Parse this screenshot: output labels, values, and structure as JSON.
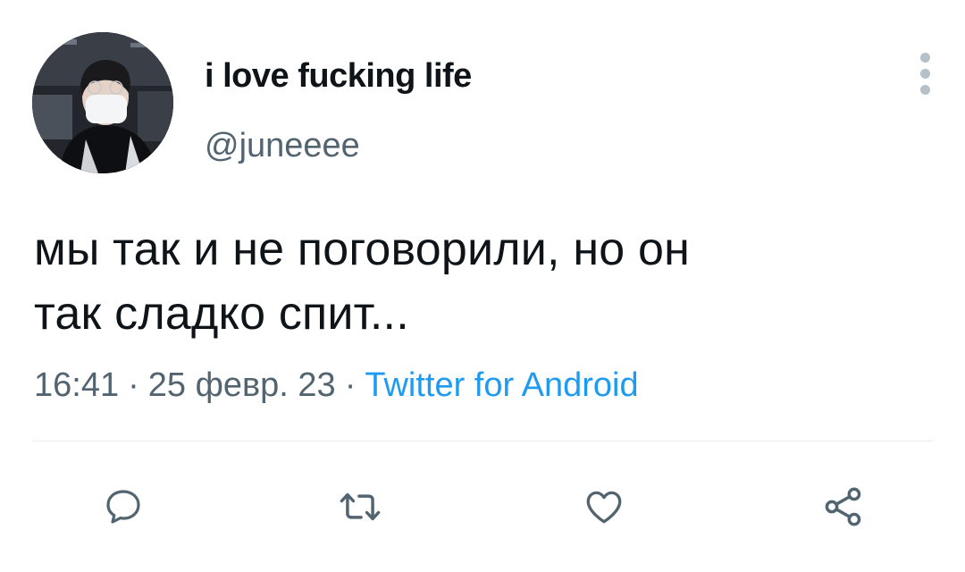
{
  "user": {
    "display_name": "i love fucking life",
    "handle": "@juneeee"
  },
  "tweet": {
    "text_line1": "мы так и не поговорили, но он",
    "text_line2": "так сладко спит...",
    "time": "16:41",
    "date": "25 февр. 23",
    "separator": "·",
    "source": "Twitter for Android"
  },
  "actions": {
    "icons": [
      "reply-icon",
      "retweet-icon",
      "like-icon",
      "share-icon"
    ]
  },
  "colors": {
    "text": "#0f1419",
    "secondary": "#536471",
    "accent": "#1d9bf0",
    "icon": "#536471",
    "divider": "#e6ecf0"
  }
}
